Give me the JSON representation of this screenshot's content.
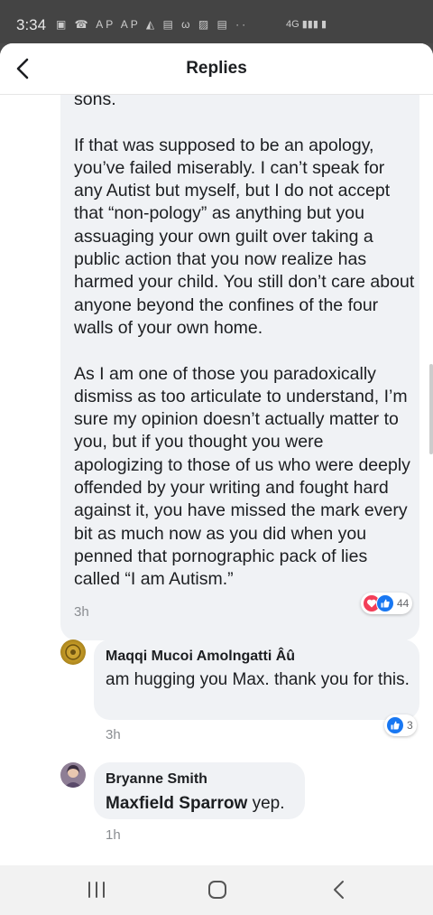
{
  "status": {
    "time": "3:34",
    "icons": "▣ ☎ AP AP ◭ ▤ ω ▨ ▤ ··",
    "right": "4G ▮▮▮ ▮"
  },
  "header": {
    "title": "Replies",
    "back_icon": "chevron-left-icon"
  },
  "main_comment": {
    "paragraphs": [
      "sons.",
      "If that was supposed to be an apology, you’ve failed miserably. I can’t speak for any Autist but myself, but I do not accept that “non-pology” as anything but you assuaging your own guilt over taking a public action that you now realize has harmed your child. You still don’t care about anyone beyond the confines of the four walls of your own home.",
      "As I am one of those you paradoxically dismiss as too articulate to understand, I’m sure my opinion doesn’t actually matter to you, but if you thought you were apologizing to those of us who were deeply offended by your writing and fought hard against it, you have missed the mark every bit as much now as you did when you penned that pornographic pack of lies called “I am Autism.”"
    ],
    "time": "3h",
    "reaction_count": "44",
    "reaction_icons": [
      "love-icon",
      "like-icon"
    ]
  },
  "replies": [
    {
      "author": "Maqqi Mucoi Amolngatti Âû",
      "text": "am hugging you Max. thank you for this.",
      "time": "3h",
      "reaction_count": "3",
      "reaction_icons": [
        "like-icon"
      ]
    },
    {
      "author": "Bryanne Smith",
      "mention": "Maxfield Sparrow",
      "text": " yep.",
      "time": "1h"
    }
  ],
  "colors": {
    "accent": "#1877f2",
    "love": "#f33e58",
    "bubble": "#f0f2f5",
    "text": "#1c1e21",
    "meta": "#8a8d91"
  },
  "navbar": {
    "icons": [
      "recent-apps-icon",
      "home-icon",
      "back-icon"
    ]
  }
}
